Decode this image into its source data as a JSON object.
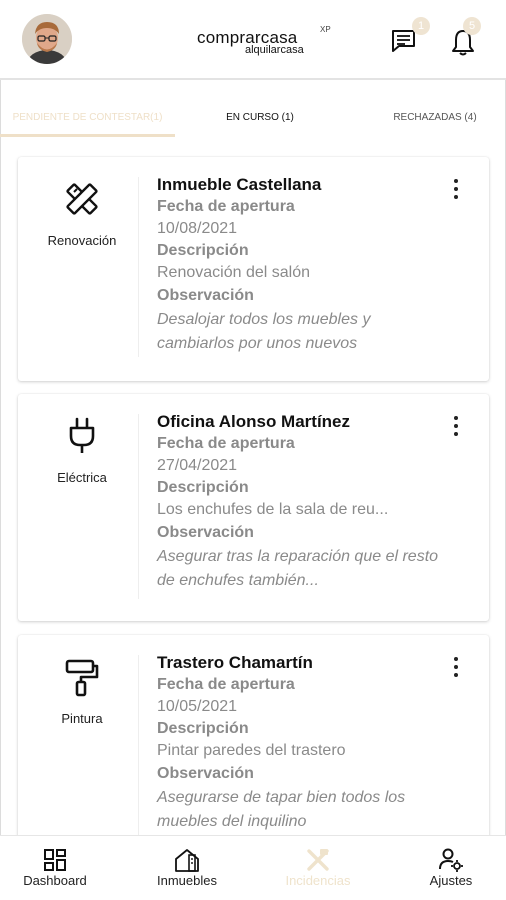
{
  "header": {
    "logo_main": "comprarcasa",
    "logo_sup": "XP",
    "logo_sub": "alquilarcasa",
    "messages_badge": "1",
    "notifications_badge": "5",
    "icons": {
      "avatar": "user-avatar",
      "messages": "chat-icon",
      "notifications": "bell-icon"
    }
  },
  "tabs": [
    {
      "label": "PENDIENTE DE CONTESTAR(1)",
      "active": true
    },
    {
      "label": "EN CURSO (1)",
      "active": false
    },
    {
      "label": "RECHAZADAS (4)",
      "active": false
    }
  ],
  "cards": [
    {
      "category": "Renovación",
      "icon": "tools-ruler-pencil-icon",
      "title": "Inmueble Castellana",
      "fecha_label": "Fecha de apertura",
      "fecha": "10/08/2021",
      "descripcion_label": "Descripción",
      "descripcion": "Renovación del salón",
      "observacion_label": "Observación",
      "observacion": "Desalojar todos los muebles y cambiarlos por unos nuevos"
    },
    {
      "category": "Eléctrica",
      "icon": "plug-icon",
      "title": "Oficina Alonso Martínez",
      "fecha_label": "Fecha de apertura",
      "fecha": "27/04/2021",
      "descripcion_label": "Descripción",
      "descripcion": "Los enchufes de la sala de reu...",
      "observacion_label": "Observación",
      "observacion": "Asegurar tras la reparación que el resto de enchufes también..."
    },
    {
      "category": "Pintura",
      "icon": "paint-roller-icon",
      "title": "Trastero Chamartín",
      "fecha_label": "Fecha de apertura",
      "fecha": "10/05/2021",
      "descripcion_label": "Descripción",
      "descripcion": "Pintar paredes del trastero",
      "observacion_label": "Observación",
      "observacion": "Asegurarse de tapar bien todos los muebles del inquilino"
    }
  ],
  "bottom_nav": [
    {
      "label": "Dashboard",
      "icon": "dashboard-grid-icon",
      "active": false
    },
    {
      "label": "Inmuebles",
      "icon": "house-icon",
      "active": false
    },
    {
      "label": "Incidencias",
      "icon": "tools-icon",
      "active": true
    },
    {
      "label": "Ajustes",
      "icon": "user-settings-icon",
      "active": false
    }
  ],
  "colors": {
    "accent": "#efe0c8",
    "muted_text": "#8a8a8a"
  }
}
